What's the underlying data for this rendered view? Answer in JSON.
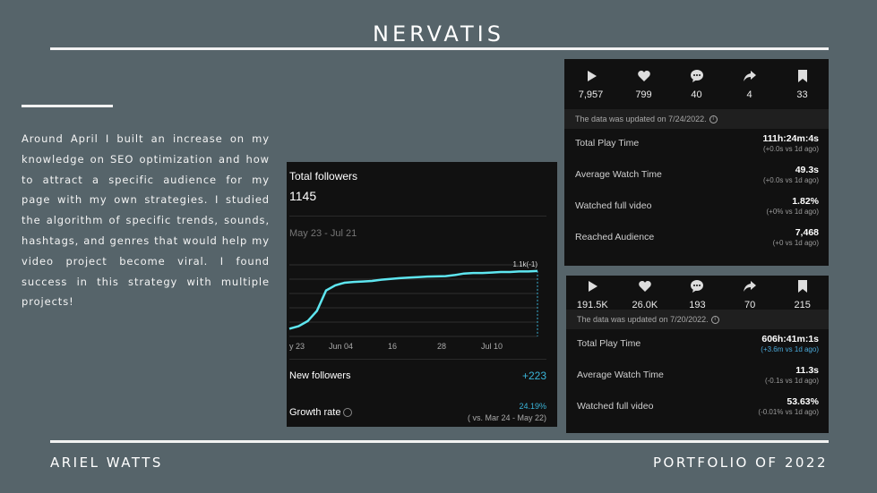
{
  "title": "NERVATIS",
  "paragraph": "Around April I built an increase on my knowledge on SEO optimization and how to attract a specific audience for my page with my own strategies. I studied the algorithm of specific trends, sounds, hashtags, and genres that would help my video project become viral. I found success in this strategy with multiple projects!",
  "footer": {
    "left": "ARIEL WATTS",
    "right": "PORTFOLIO OF 2022"
  },
  "panel1": {
    "stats": [
      {
        "icon": "play-icon",
        "value": "7,957"
      },
      {
        "icon": "heart-icon",
        "value": "799"
      },
      {
        "icon": "comment-icon",
        "value": "40"
      },
      {
        "icon": "share-icon",
        "value": "4"
      },
      {
        "icon": "bookmark-icon",
        "value": "33"
      }
    ],
    "updated": "The data was updated on 7/24/2022.",
    "metrics": [
      {
        "label": "Total Play Time",
        "value": "111h:24m:4s",
        "sub": "(+0.0s vs 1d ago)"
      },
      {
        "label": "Average Watch Time",
        "value": "49.3s",
        "sub": "(+0.0s vs 1d ago)"
      },
      {
        "label": "Watched full video",
        "value": "1.82%",
        "sub": "(+0% vs 1d ago)"
      },
      {
        "label": "Reached Audience",
        "value": "7,468",
        "sub": "(+0 vs 1d ago)"
      }
    ]
  },
  "panel2": {
    "stats": [
      {
        "icon": "play-icon",
        "value": "191.5K"
      },
      {
        "icon": "heart-icon",
        "value": "26.0K"
      },
      {
        "icon": "comment-icon",
        "value": "193"
      },
      {
        "icon": "share-icon",
        "value": "70"
      },
      {
        "icon": "bookmark-icon",
        "value": "215"
      }
    ],
    "updated": "The data was updated on 7/20/2022.",
    "metrics": [
      {
        "label": "Total Play Time",
        "value": "606h:41m:1s",
        "sub": "(+3.6m vs 1d ago)"
      },
      {
        "label": "Average Watch Time",
        "value": "11.3s",
        "sub": "(-0.1s vs 1d ago)"
      },
      {
        "label": "Watched full video",
        "value": "53.63%",
        "sub": "(-0.01% vs 1d ago)"
      }
    ]
  },
  "followers": {
    "title": "Total followers",
    "total": "1145",
    "range": "May 23 - Jul 21",
    "new_label": "New followers",
    "new_value": "+223",
    "growth_label": "Growth rate",
    "growth_value": "24.19%",
    "growth_sub": "( vs. Mar 24 - May 22)"
  },
  "chart_data": {
    "type": "line",
    "title": "Total followers",
    "x_tick_labels": [
      "y 23",
      "Jun 04",
      "16",
      "28",
      "Jul 10"
    ],
    "annotation": "1.1k(-1)",
    "series": [
      {
        "values": [
          0.89,
          0.9,
          0.92,
          0.96,
          1.04,
          1.06,
          1.07,
          1.073,
          1.075,
          1.077,
          1.082,
          1.085,
          1.088,
          1.09,
          1.092,
          1.094,
          1.095,
          1.096,
          1.1,
          1.106,
          1.108,
          1.108,
          1.11,
          1.112,
          1.112,
          1.114,
          1.114,
          1.116
        ]
      }
    ],
    "ylim": [
      0.86,
      1.14
    ],
    "grid": true,
    "color": "#5ee6f0"
  },
  "colors": {
    "background": "#56646a",
    "panel": "#111111",
    "accent": "#3ab4d8",
    "line": "#5ee6f0"
  }
}
